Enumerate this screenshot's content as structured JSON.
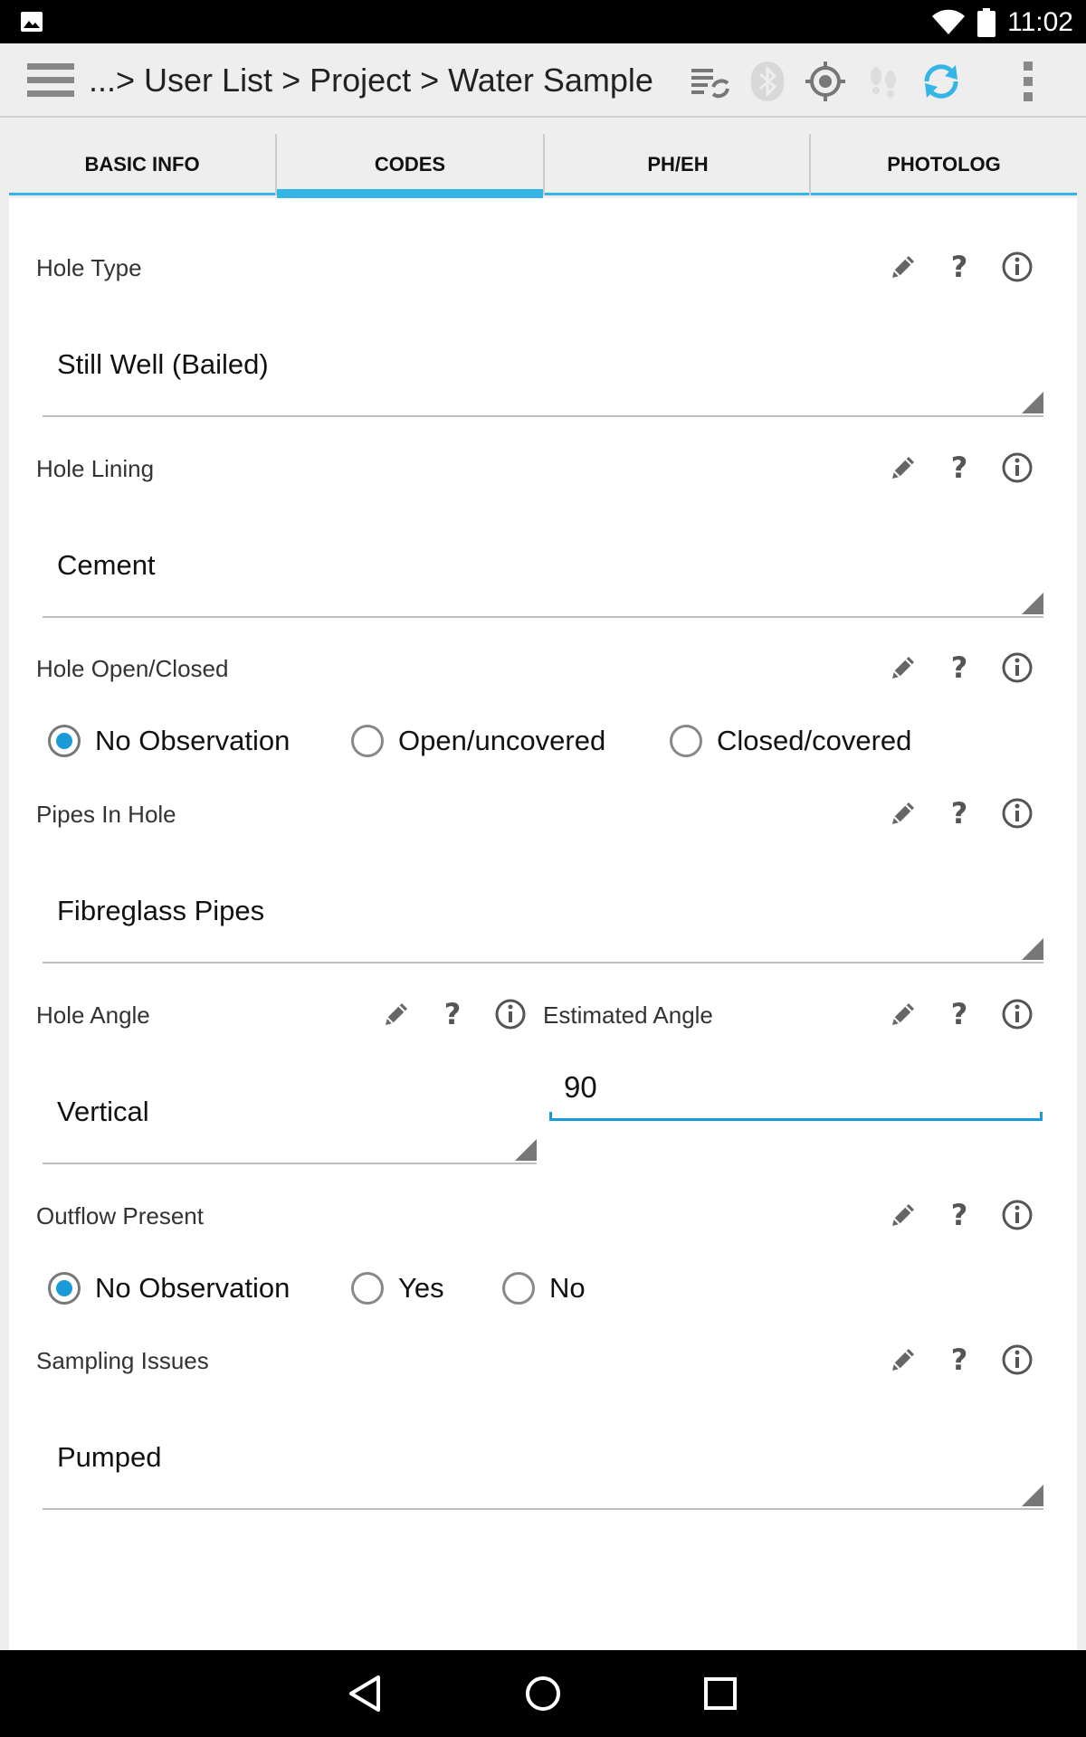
{
  "status_bar": {
    "time": "11:02"
  },
  "action_bar": {
    "title": "...> User List > Project > Water Sample"
  },
  "tabs": [
    {
      "label": "BASIC INFO"
    },
    {
      "label": "CODES",
      "active": true
    },
    {
      "label": "PH/EH"
    },
    {
      "label": "PHOTOLOG"
    }
  ],
  "fields": {
    "hole_type": {
      "label": "Hole Type",
      "value": "Still Well (Bailed)"
    },
    "hole_lining": {
      "label": "Hole Lining",
      "value": "Cement"
    },
    "hole_open_closed": {
      "label": "Hole Open/Closed",
      "options": [
        "No Observation",
        "Open/uncovered",
        "Closed/covered"
      ],
      "selected": "No Observation"
    },
    "pipes_in_hole": {
      "label": "Pipes In Hole",
      "value": "Fibreglass Pipes"
    },
    "hole_angle": {
      "label": "Hole Angle",
      "value": "Vertical"
    },
    "estimated_angle": {
      "label": "Estimated Angle",
      "value": "90"
    },
    "outflow_present": {
      "label": "Outflow Present",
      "options": [
        "No Observation",
        "Yes",
        "No"
      ],
      "selected": "No Observation"
    },
    "sampling_issues": {
      "label": "Sampling Issues",
      "value": "Pumped"
    }
  },
  "icons": {
    "edit": "pencil-icon",
    "help": "?",
    "info": "info-icon"
  },
  "colors": {
    "accent": "#33b5e5",
    "radio_selected": "#1a9bd7",
    "sync_active": "#33b5e5"
  }
}
